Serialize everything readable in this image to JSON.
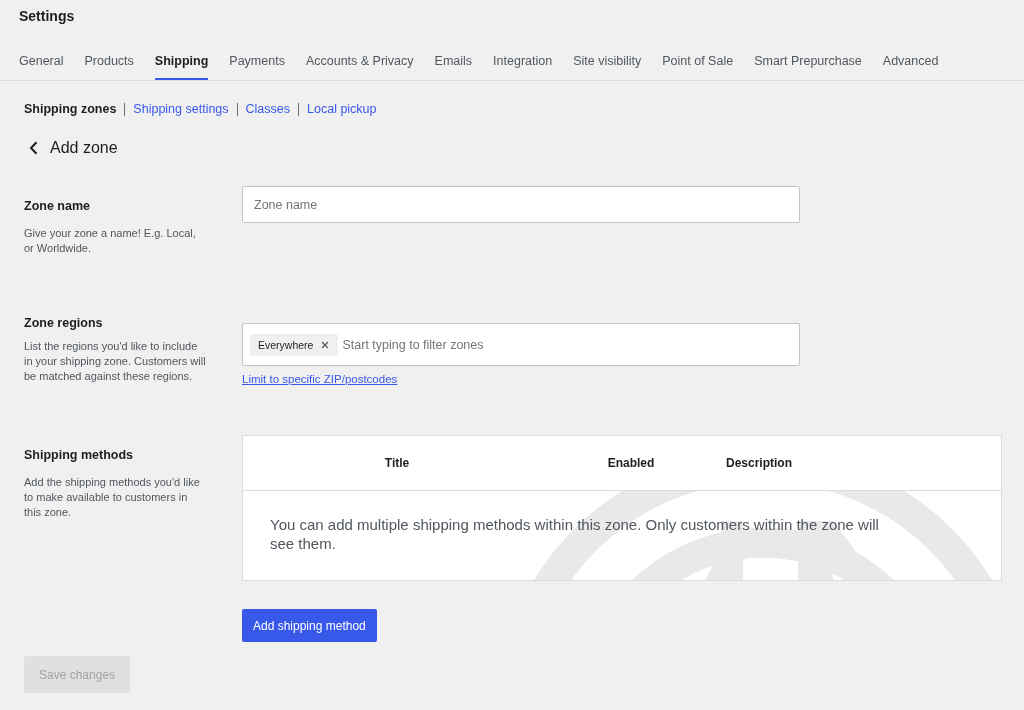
{
  "header": {
    "title": "Settings"
  },
  "tabs": [
    {
      "label": "General",
      "selected": false
    },
    {
      "label": "Products",
      "selected": false
    },
    {
      "label": "Shipping",
      "selected": true
    },
    {
      "label": "Payments",
      "selected": false
    },
    {
      "label": "Accounts & Privacy",
      "selected": false
    },
    {
      "label": "Emails",
      "selected": false
    },
    {
      "label": "Integration",
      "selected": false
    },
    {
      "label": "Site visibility",
      "selected": false
    },
    {
      "label": "Point of Sale",
      "selected": false
    },
    {
      "label": "Smart Prepurchase",
      "selected": false
    },
    {
      "label": "Advanced",
      "selected": false
    }
  ],
  "subnav": [
    {
      "label": "Shipping zones",
      "selected": true
    },
    {
      "label": "Shipping settings",
      "selected": false
    },
    {
      "label": "Classes",
      "selected": false
    },
    {
      "label": "Local pickup",
      "selected": false
    }
  ],
  "page_title": "Add zone",
  "sections": [
    {
      "kind": "text",
      "heading": "Zone name",
      "description": "Give your zone a name! E.g. Local, or Worldwide.",
      "placeholder": "Zone name"
    },
    {
      "kind": "tokens",
      "heading": "Zone regions",
      "description": "List the regions you'd like to include in your shipping zone. Customers will be matched against these regions.",
      "tokens": [
        {
          "label": "Everywhere"
        }
      ],
      "placeholder": "Start typing to filter zones",
      "link": "Limit to specific ZIP/postcodes"
    },
    {
      "kind": "table",
      "heading": "Shipping methods",
      "description": "Add the shipping methods you'd like to make available to customers in this zone.",
      "columns": [
        "Title",
        "Enabled",
        "Description"
      ],
      "empty_message": "You can add multiple shipping methods within this zone. Only customers within the zone will see them.",
      "button": "Add shipping method"
    }
  ],
  "save_button": {
    "label": "Save changes",
    "disabled": true
  }
}
